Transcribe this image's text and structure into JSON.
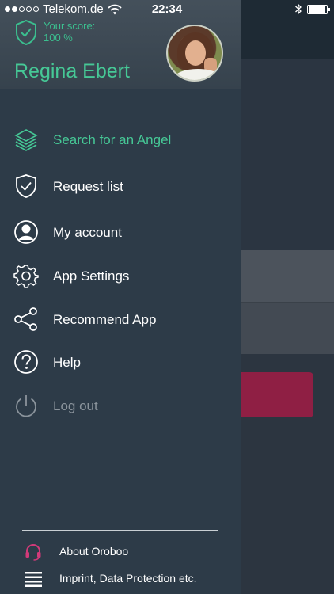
{
  "status_bar": {
    "carrier": "Telekom.de",
    "time": "22:34"
  },
  "profile": {
    "score_label": "Your score:",
    "score_value": "100 %",
    "name": "Regina Ebert"
  },
  "menu": {
    "items": [
      {
        "label": "Search for an Angel",
        "icon": "layers-icon",
        "active": true
      },
      {
        "label": "Request list",
        "icon": "shield-check-icon"
      },
      {
        "label": "My account",
        "icon": "user-icon"
      },
      {
        "label": "App Settings",
        "icon": "gear-icon"
      },
      {
        "label": "Recommend App",
        "icon": "share-icon"
      },
      {
        "label": "Help",
        "icon": "help-icon"
      },
      {
        "label": "Log out",
        "icon": "power-icon",
        "disabled": true
      }
    ]
  },
  "footer": {
    "about": "About Oroboo",
    "imprint": "Imprint, Data Protection etc."
  },
  "colors": {
    "accent": "#46c896",
    "drawer_bg": "#2d3b48",
    "about_icon": "#d13a79"
  }
}
